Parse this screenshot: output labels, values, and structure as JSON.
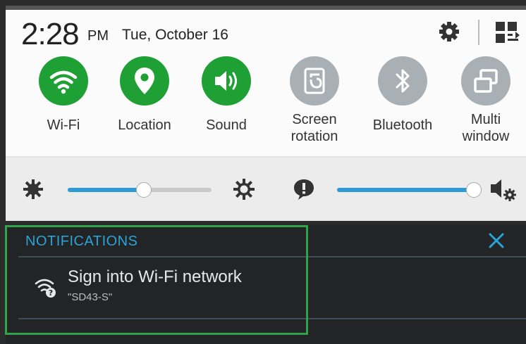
{
  "status": {
    "time": "2:28",
    "ampm": "PM",
    "date": "Tue, October 16"
  },
  "icons": {
    "settings": "gear-icon",
    "edit": "grid-edit-icon"
  },
  "tiles": [
    {
      "label": "Wi-Fi",
      "state": "on",
      "icon": "wifi-icon"
    },
    {
      "label": "Location",
      "state": "on",
      "icon": "location-icon"
    },
    {
      "label": "Sound",
      "state": "on",
      "icon": "sound-icon"
    },
    {
      "label1": "Screen",
      "label2": "rotation",
      "state": "off",
      "icon": "screen-rotation-icon"
    },
    {
      "label": "Bluetooth",
      "state": "off",
      "icon": "bluetooth-icon"
    },
    {
      "label1": "Multi",
      "label2": "window",
      "state": "off",
      "icon": "multi-window-icon"
    }
  ],
  "brightness": {
    "level": 0.53
  },
  "volume": {
    "level": 0.97
  },
  "notifications": {
    "title": "NOTIFICATIONS",
    "items": [
      {
        "message": "Sign into Wi-Fi network",
        "sub": "\"SD43-S\""
      }
    ]
  },
  "colors": {
    "on": "#1fa034",
    "off": "#a9b0b5",
    "accent": "#2aa4d8",
    "highlight": "#2fa24a"
  }
}
